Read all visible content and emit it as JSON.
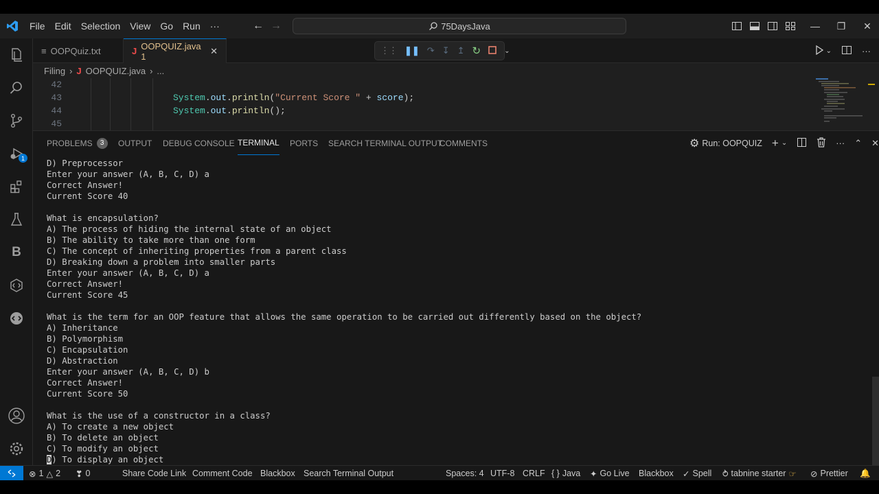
{
  "menu": [
    "File",
    "Edit",
    "Selection",
    "View",
    "Go",
    "Run",
    "···"
  ],
  "search": {
    "text": "75DaysJava"
  },
  "tabs": [
    {
      "label": "OOPQuiz.txt"
    },
    {
      "label": "OOPQUIZ.java 1",
      "icon": "J"
    }
  ],
  "breadcrumb": {
    "folder": "Filing",
    "sep1": "›",
    "icon": "J",
    "file": "OOPQUIZ.java",
    "sep2": "›",
    "more": "..."
  },
  "activity_badge": "1",
  "code": [
    {
      "num": "42",
      "text": ""
    },
    {
      "num": "43",
      "text": "System.out.println(\"Current Score \" + score);"
    },
    {
      "num": "44",
      "text": "System.out.println();"
    },
    {
      "num": "45",
      "text": ""
    }
  ],
  "panel": {
    "tabs": {
      "problems": "PROBLEMS",
      "problems_count": "3",
      "output": "OUTPUT",
      "debug_console": "DEBUG CONSOLE",
      "terminal": "TERMINAL",
      "ports": "PORTS",
      "search_terminal": "SEARCH TERMINAL OUTPUT",
      "comments": "COMMENTS"
    },
    "run_label": "Run: OOPQUIZ"
  },
  "terminal_lines": [
    "D) Preprocessor",
    "Enter your answer (A, B, C, D) a",
    "Correct Answer!",
    "Current Score 40",
    "",
    "What is encapsulation?",
    "A) The process of hiding the internal state of an object",
    "B) The ability to take more than one form",
    "C) The concept of inheriting properties from a parent class",
    "D) Breaking down a problem into smaller parts",
    "Enter your answer (A, B, C, D) a",
    "Correct Answer!",
    "Current Score 45",
    "",
    "What is the term for an OOP feature that allows the same operation to be carried out differently based on the object?",
    "A) Inheritance",
    "B) Polymorphism",
    "C) Encapsulation",
    "D) Abstraction",
    "Enter your answer (A, B, C, D) b",
    "Correct Answer!",
    "Current Score 50",
    "",
    "What is the use of a constructor in a class?",
    "A) To create a new object",
    "B) To delete an object",
    "C) To modify an object"
  ],
  "terminal_last": {
    "cursor": "D",
    "rest": ") To display an object"
  },
  "status": {
    "errors": "1",
    "warnings": "2",
    "ports": "0",
    "share": "Share Code Link",
    "comment": "Comment Code",
    "blackbox1": "Blackbox",
    "search_out": "Search Terminal Output",
    "spaces": "Spaces: 4",
    "encoding": "UTF-8",
    "eol": "CRLF",
    "lang_icon": "{ }",
    "lang": "Java",
    "golive": "Go Live",
    "blackbox2": "Blackbox",
    "spell": "Spell",
    "tabnine": "tabnine starter",
    "prettier": "Prettier"
  },
  "colors": {
    "accent": "#0078d4",
    "java_icon": "#f14c4c",
    "modified_tab": "#e2c08d",
    "debug_blue": "#75beff",
    "debug_green": "#89d185",
    "debug_red": "#f48771"
  }
}
